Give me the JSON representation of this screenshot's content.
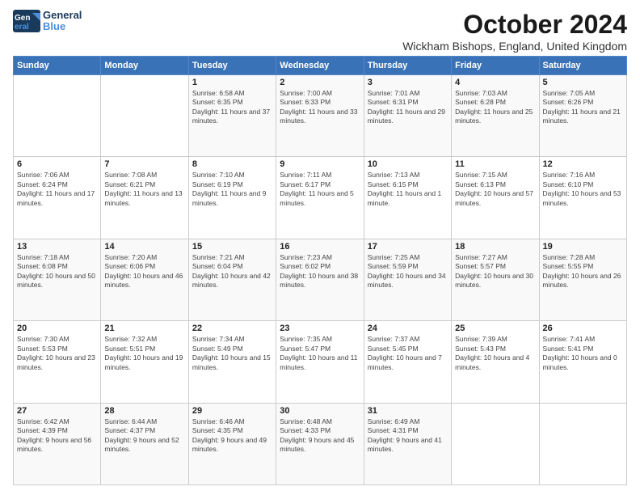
{
  "header": {
    "logo_line1": "General",
    "logo_line2": "Blue",
    "month": "October 2024",
    "location": "Wickham Bishops, England, United Kingdom"
  },
  "days_of_week": [
    "Sunday",
    "Monday",
    "Tuesday",
    "Wednesday",
    "Thursday",
    "Friday",
    "Saturday"
  ],
  "weeks": [
    [
      {
        "day": "",
        "content": ""
      },
      {
        "day": "",
        "content": ""
      },
      {
        "day": "1",
        "content": "Sunrise: 6:58 AM\nSunset: 6:35 PM\nDaylight: 11 hours and 37 minutes."
      },
      {
        "day": "2",
        "content": "Sunrise: 7:00 AM\nSunset: 6:33 PM\nDaylight: 11 hours and 33 minutes."
      },
      {
        "day": "3",
        "content": "Sunrise: 7:01 AM\nSunset: 6:31 PM\nDaylight: 11 hours and 29 minutes."
      },
      {
        "day": "4",
        "content": "Sunrise: 7:03 AM\nSunset: 6:28 PM\nDaylight: 11 hours and 25 minutes."
      },
      {
        "day": "5",
        "content": "Sunrise: 7:05 AM\nSunset: 6:26 PM\nDaylight: 11 hours and 21 minutes."
      }
    ],
    [
      {
        "day": "6",
        "content": "Sunrise: 7:06 AM\nSunset: 6:24 PM\nDaylight: 11 hours and 17 minutes."
      },
      {
        "day": "7",
        "content": "Sunrise: 7:08 AM\nSunset: 6:21 PM\nDaylight: 11 hours and 13 minutes."
      },
      {
        "day": "8",
        "content": "Sunrise: 7:10 AM\nSunset: 6:19 PM\nDaylight: 11 hours and 9 minutes."
      },
      {
        "day": "9",
        "content": "Sunrise: 7:11 AM\nSunset: 6:17 PM\nDaylight: 11 hours and 5 minutes."
      },
      {
        "day": "10",
        "content": "Sunrise: 7:13 AM\nSunset: 6:15 PM\nDaylight: 11 hours and 1 minute."
      },
      {
        "day": "11",
        "content": "Sunrise: 7:15 AM\nSunset: 6:13 PM\nDaylight: 10 hours and 57 minutes."
      },
      {
        "day": "12",
        "content": "Sunrise: 7:16 AM\nSunset: 6:10 PM\nDaylight: 10 hours and 53 minutes."
      }
    ],
    [
      {
        "day": "13",
        "content": "Sunrise: 7:18 AM\nSunset: 6:08 PM\nDaylight: 10 hours and 50 minutes."
      },
      {
        "day": "14",
        "content": "Sunrise: 7:20 AM\nSunset: 6:06 PM\nDaylight: 10 hours and 46 minutes."
      },
      {
        "day": "15",
        "content": "Sunrise: 7:21 AM\nSunset: 6:04 PM\nDaylight: 10 hours and 42 minutes."
      },
      {
        "day": "16",
        "content": "Sunrise: 7:23 AM\nSunset: 6:02 PM\nDaylight: 10 hours and 38 minutes."
      },
      {
        "day": "17",
        "content": "Sunrise: 7:25 AM\nSunset: 5:59 PM\nDaylight: 10 hours and 34 minutes."
      },
      {
        "day": "18",
        "content": "Sunrise: 7:27 AM\nSunset: 5:57 PM\nDaylight: 10 hours and 30 minutes."
      },
      {
        "day": "19",
        "content": "Sunrise: 7:28 AM\nSunset: 5:55 PM\nDaylight: 10 hours and 26 minutes."
      }
    ],
    [
      {
        "day": "20",
        "content": "Sunrise: 7:30 AM\nSunset: 5:53 PM\nDaylight: 10 hours and 23 minutes."
      },
      {
        "day": "21",
        "content": "Sunrise: 7:32 AM\nSunset: 5:51 PM\nDaylight: 10 hours and 19 minutes."
      },
      {
        "day": "22",
        "content": "Sunrise: 7:34 AM\nSunset: 5:49 PM\nDaylight: 10 hours and 15 minutes."
      },
      {
        "day": "23",
        "content": "Sunrise: 7:35 AM\nSunset: 5:47 PM\nDaylight: 10 hours and 11 minutes."
      },
      {
        "day": "24",
        "content": "Sunrise: 7:37 AM\nSunset: 5:45 PM\nDaylight: 10 hours and 7 minutes."
      },
      {
        "day": "25",
        "content": "Sunrise: 7:39 AM\nSunset: 5:43 PM\nDaylight: 10 hours and 4 minutes."
      },
      {
        "day": "26",
        "content": "Sunrise: 7:41 AM\nSunset: 5:41 PM\nDaylight: 10 hours and 0 minutes."
      }
    ],
    [
      {
        "day": "27",
        "content": "Sunrise: 6:42 AM\nSunset: 4:39 PM\nDaylight: 9 hours and 56 minutes."
      },
      {
        "day": "28",
        "content": "Sunrise: 6:44 AM\nSunset: 4:37 PM\nDaylight: 9 hours and 52 minutes."
      },
      {
        "day": "29",
        "content": "Sunrise: 6:46 AM\nSunset: 4:35 PM\nDaylight: 9 hours and 49 minutes."
      },
      {
        "day": "30",
        "content": "Sunrise: 6:48 AM\nSunset: 4:33 PM\nDaylight: 9 hours and 45 minutes."
      },
      {
        "day": "31",
        "content": "Sunrise: 6:49 AM\nSunset: 4:31 PM\nDaylight: 9 hours and 41 minutes."
      },
      {
        "day": "",
        "content": ""
      },
      {
        "day": "",
        "content": ""
      }
    ]
  ]
}
